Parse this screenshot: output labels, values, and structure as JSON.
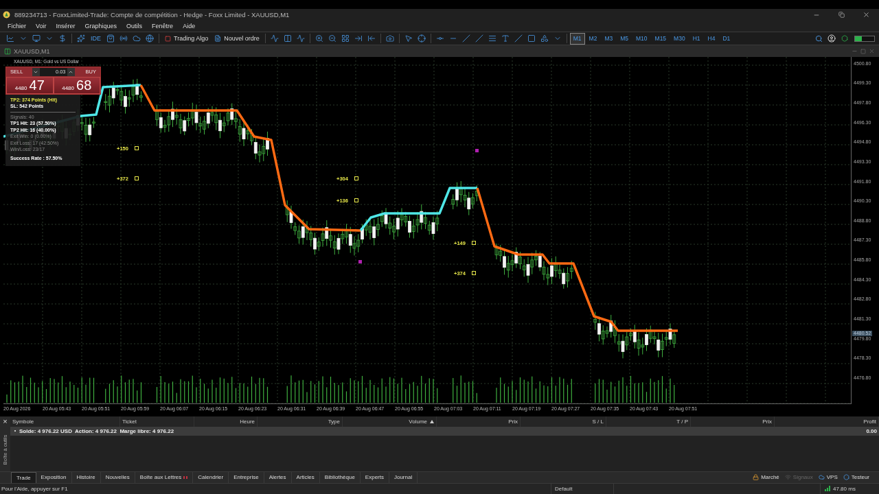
{
  "window": {
    "title": "889234713 - FoxxLimited-Trade: Compte de compétition - Hedge - Foxx Limited - XAUUSD,M1"
  },
  "menu": [
    "Fichier",
    "Voir",
    "Insérer",
    "Graphiques",
    "Outils",
    "Fenêtre",
    "Aide"
  ],
  "toolbar": {
    "ide_label": "IDE",
    "buttons": [
      "Trading Algo",
      "Nouvel ordre"
    ],
    "timeframes": [
      {
        "label": "M1",
        "selected": true
      },
      {
        "label": "M2",
        "selected": false
      },
      {
        "label": "M3",
        "selected": false
      },
      {
        "label": "M5",
        "selected": false
      },
      {
        "label": "M10",
        "selected": false
      },
      {
        "label": "M15",
        "selected": false
      },
      {
        "label": "M30",
        "selected": false
      },
      {
        "label": "H1",
        "selected": false
      },
      {
        "label": "H4",
        "selected": false
      },
      {
        "label": "D1",
        "selected": false
      }
    ],
    "level_meter": {
      "level": 0.35
    }
  },
  "chart_tab": {
    "title": "XAUUSD,M1"
  },
  "chart": {
    "header": "XAUUSD, M1:  Gold vs US Dollar",
    "one_click": {
      "sell": "SELL",
      "buy": "BUY",
      "volume": "0.03",
      "sell_price": {
        "prefix": "4480",
        "digits": "47"
      },
      "buy_price": {
        "prefix": "4480",
        "digits": "68"
      }
    },
    "levels": [
      {
        "text": "TP2: 374 Points (Hit)",
        "kind": "highlight"
      },
      {
        "text": "SL: 542 Points",
        "kind": "bold"
      }
    ],
    "stats": [
      {
        "text": "Signals: 40",
        "kind": "muted"
      },
      {
        "text": "TP1 Hit: 23 (57.50%)",
        "kind": "bold"
      },
      {
        "text": "TP2 Hit: 16 (40.00%)",
        "kind": "bold"
      },
      {
        "text": "Exit Win: 0 (0.00%)",
        "kind": "muted"
      },
      {
        "text": "Exit Loss: 17 (42.50%)",
        "kind": "muted"
      },
      {
        "text": "Win/Loss: 23/17",
        "kind": "muted"
      },
      {
        "text": "Success Rate : 57.50%",
        "kind": "total"
      }
    ],
    "trade_labels": [
      "+150",
      "+372",
      "+304",
      "+136",
      "+149",
      "+374"
    ],
    "price_axis": {
      "labels": [
        "4500.80",
        "4499.30",
        "4497.80",
        "4496.30",
        "4494.80",
        "4493.30",
        "4491.80",
        "4490.30",
        "4488.80",
        "4487.30",
        "4485.80",
        "4484.30",
        "4482.80",
        "4481.30",
        "4479.80",
        "4478.30",
        "4476.80"
      ],
      "current_price": "4480.52"
    },
    "time_axis": [
      "20 Aug 2026",
      "20 Aug 05:43",
      "20 Aug 05:51",
      "20 Aug 05:59",
      "20 Aug 06:07",
      "20 Aug 06:15",
      "20 Aug 06:23",
      "20 Aug 06:31",
      "20 Aug 06:39",
      "20 Aug 06:47",
      "20 Aug 06:55",
      "20 Aug 07:03",
      "20 Aug 07:11",
      "20 Aug 07:19",
      "20 Aug 07:27",
      "20 Aug 07:35",
      "20 Aug 07:43",
      "20 Aug 07:51"
    ]
  },
  "terminal": {
    "side_label": "Boîte à outils",
    "close": "×",
    "columns": [
      {
        "label": "Symbole",
        "sorted": false
      },
      {
        "label": "Ticket",
        "sorted": false
      },
      {
        "label": "Heure",
        "sorted": false
      },
      {
        "label": "Type",
        "sorted": false
      },
      {
        "label": "Volume",
        "sorted": true
      },
      {
        "label": "Prix",
        "sorted": false
      },
      {
        "label": "S / L",
        "sorted": false
      },
      {
        "label": "T / P",
        "sorted": false
      },
      {
        "label": "Prix",
        "sorted": false
      },
      {
        "label": "Profit",
        "sorted": false
      }
    ],
    "balance_row": {
      "summary": "Solde: 4 976.22 USD  Action: 4 976.22  Marge libre: 4 976.22",
      "profit": "0.00"
    },
    "tabs": [
      {
        "label": "Trade",
        "selected": true
      },
      {
        "label": "Exposition",
        "selected": false
      },
      {
        "label": "Histoire",
        "selected": false
      },
      {
        "label": "Nouvelles",
        "selected": false
      },
      {
        "label": "Boîte aux Lettres",
        "selected": false
      },
      {
        "label": "Calendrier",
        "selected": false
      },
      {
        "label": "Entreprise",
        "selected": false
      },
      {
        "label": "Alertes",
        "selected": false
      },
      {
        "label": "Articles",
        "selected": false
      },
      {
        "label": "Bibliothèque",
        "selected": false
      },
      {
        "label": "Experts",
        "selected": false
      },
      {
        "label": "Journal",
        "selected": false
      }
    ],
    "shortcuts": [
      {
        "label": "Marché",
        "disabled": false
      },
      {
        "label": "Signaux",
        "disabled": true
      },
      {
        "label": "VPS",
        "disabled": false
      },
      {
        "label": "Testeur",
        "disabled": false
      }
    ]
  },
  "status_bar": {
    "help": "Pour l'Aide, appuyer sur F1",
    "profile": "Default",
    "ping": "47.80 ms"
  }
}
